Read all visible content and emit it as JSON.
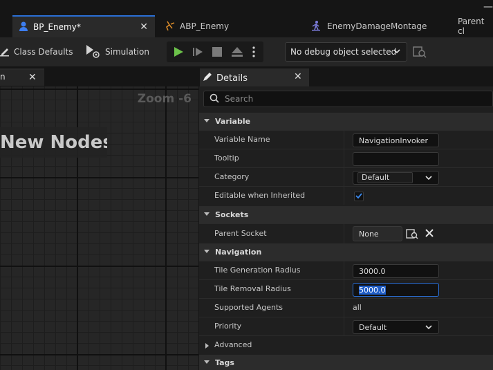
{
  "tabs": [
    {
      "label": "BP_Enemy*"
    },
    {
      "label": "ABP_Enemy"
    },
    {
      "label": "EnemyDamageMontage"
    },
    {
      "label": "Parent cl"
    }
  ],
  "toolbar": {
    "class_defaults_label": "Class Defaults",
    "simulation_label": "Simulation",
    "debug_object": "No debug object selected"
  },
  "graph": {
    "zoom_label": "Zoom -6",
    "comment_text": "New Nodes."
  },
  "details": {
    "tab_label": "Details",
    "search_placeholder": "Search",
    "sections": {
      "variable": "Variable",
      "sockets": "Sockets",
      "navigation": "Navigation",
      "advanced": "Advanced",
      "tags": "Tags"
    },
    "rows": {
      "variable_name": {
        "label": "Variable Name",
        "value": "NavigationInvoker"
      },
      "tooltip": {
        "label": "Tooltip",
        "value": ""
      },
      "category": {
        "label": "Category",
        "value": "Default"
      },
      "editable_when_inherited": {
        "label": "Editable when Inherited",
        "checked": true
      },
      "parent_socket": {
        "label": "Parent Socket",
        "value": "None"
      },
      "tile_generation_radius": {
        "label": "Tile Generation Radius",
        "value": "3000.0"
      },
      "tile_removal_radius": {
        "label": "Tile Removal Radius",
        "value": "5000.0"
      },
      "supported_agents": {
        "label": "Supported Agents",
        "value": "all"
      },
      "priority": {
        "label": "Priority",
        "value": "Default"
      }
    }
  },
  "colors": {
    "accent": "#2a6fd6",
    "play": "#6cc24a",
    "panel": "#1f1f1f"
  }
}
